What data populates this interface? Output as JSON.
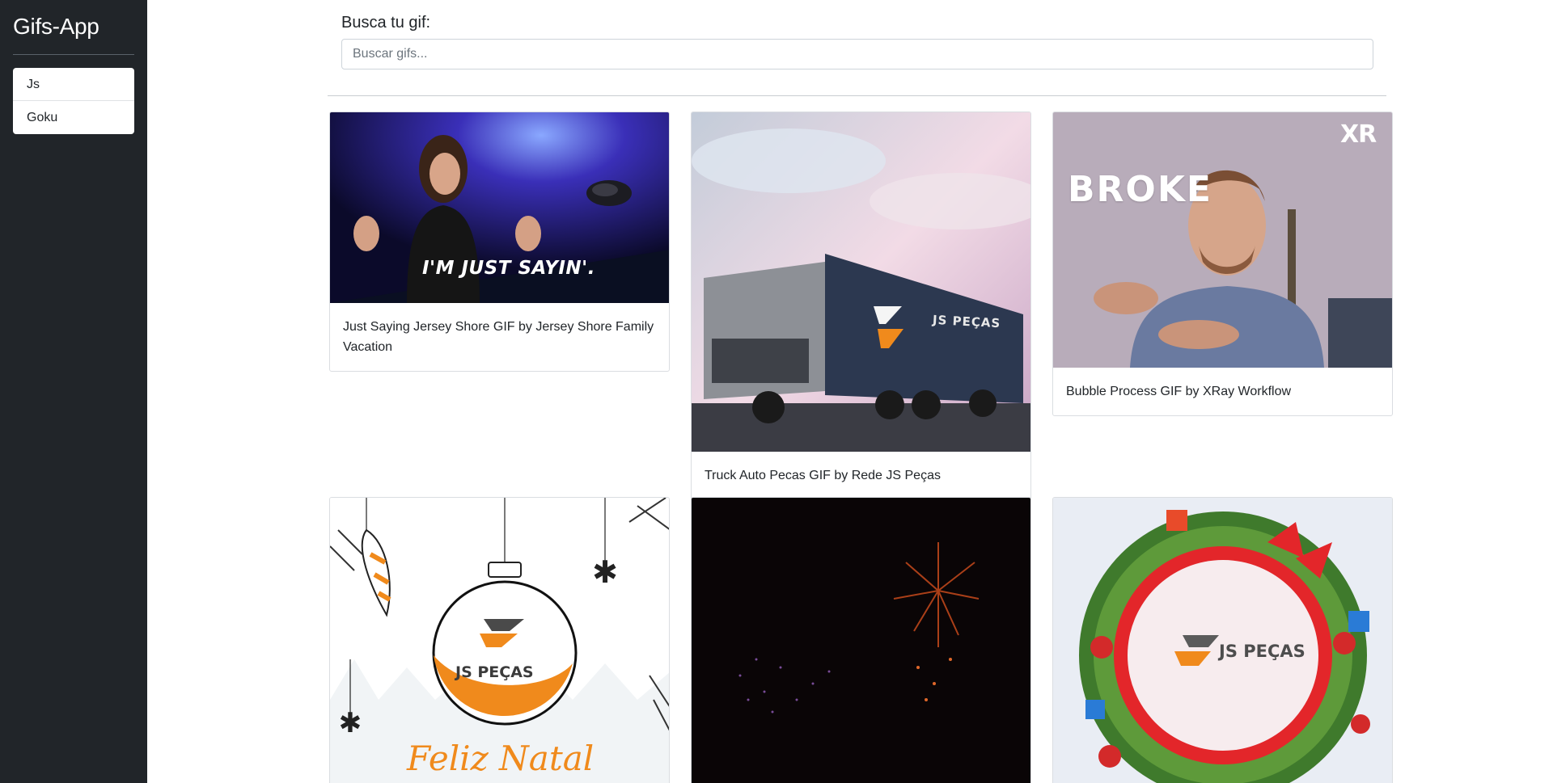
{
  "sidebar": {
    "title": "Gifs-App",
    "history": [
      "Js",
      "Goku"
    ]
  },
  "search": {
    "label": "Busca tu gif:",
    "placeholder": "Buscar gifs..."
  },
  "gifs": [
    {
      "title": "Just Saying Jersey Shore GIF by Jersey Shore Family Vacation",
      "overlay": "I'M JUST SAYIN'."
    },
    {
      "title": "Truck Auto Pecas GIF by Rede JS Peças",
      "overlay": "JS PEÇAS"
    },
    {
      "title": "Bubble Process GIF by XRay Workflow",
      "overlay": "BROKE",
      "logo": "XR"
    },
    {
      "title": "",
      "overlay": "JS PEÇAS",
      "greeting": "Feliz Natal"
    },
    {
      "title": ""
    },
    {
      "title": "",
      "overlay": "JS PEÇAS"
    }
  ],
  "colors": {
    "sidebar": "#212529",
    "accent": "#f08a1c"
  }
}
